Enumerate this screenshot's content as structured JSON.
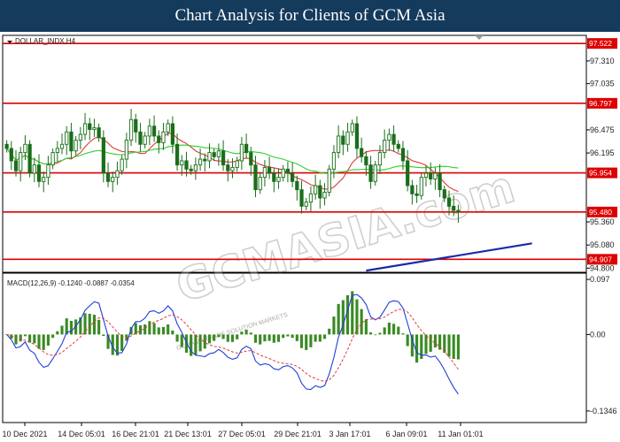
{
  "header": {
    "title": "Chart Analysis for Clients of GCM Asia"
  },
  "watermark": {
    "text": "GCMASIA.com",
    "sub": "GCMASIA TRADE SOLUTION MARKETS"
  },
  "colors": {
    "header_bg": "#143a5c",
    "candle": "#1a6e1a",
    "level_line": "#dd0000",
    "ma_red": "#e03a3a",
    "ma_green": "#2bd12b",
    "trend": "#1c2aa8",
    "macd_line": "#1f3fd8",
    "macd_signal": "#e03a3a",
    "histogram": "#3a8a24"
  },
  "chart_data": [
    {
      "type": "candlestick",
      "symbol_label": "DOLLAR_INDX,H4",
      "ylim": [
        94.75,
        97.62
      ],
      "y_ticks": [
        "97.310",
        "97.035",
        "96.475",
        "96.195",
        "95.360",
        "95.080",
        "94.800"
      ],
      "x_ticks": [
        "10 Dec 2021",
        "14 Dec 05:01",
        "16 Dec 21:01",
        "21 Dec 13:01",
        "27 Dec 05:01",
        "29 Dec 21:01",
        "3 Jan 17:01",
        "6 Jan 09:01",
        "11 Jan 01:01"
      ],
      "levels": [
        {
          "value": 97.522,
          "label": "97.522"
        },
        {
          "value": 96.797,
          "label": "96.797"
        },
        {
          "value": 95.954,
          "label": "95.954"
        },
        {
          "value": 95.48,
          "label": "95.480"
        },
        {
          "value": 94.907,
          "label": "94.907"
        }
      ],
      "trendline": {
        "from": [
          78,
          94.77
        ],
        "to": [
          114,
          95.1
        ]
      },
      "closes": [
        96.25,
        96.1,
        95.98,
        96.2,
        96.3,
        95.95,
        96.05,
        95.85,
        95.9,
        96.05,
        96.2,
        96.25,
        96.3,
        96.45,
        96.22,
        96.35,
        96.42,
        96.55,
        96.48,
        96.5,
        96.38,
        95.95,
        95.85,
        95.9,
        95.98,
        96.12,
        96.35,
        96.6,
        96.45,
        96.3,
        96.4,
        96.52,
        96.4,
        96.32,
        96.45,
        96.55,
        96.3,
        96.05,
        96.1,
        96.0,
        95.98,
        96.05,
        96.12,
        96.1,
        96.2,
        96.15,
        96.22,
        96.05,
        95.98,
        96.02,
        96.1,
        96.3,
        96.2,
        96.05,
        95.75,
        95.9,
        96.02,
        95.95,
        95.85,
        95.9,
        96.0,
        95.95,
        95.85,
        95.75,
        95.55,
        95.6,
        95.7,
        95.8,
        95.65,
        95.72,
        96.0,
        96.2,
        96.4,
        96.3,
        96.45,
        96.55,
        96.25,
        96.15,
        96.05,
        95.85,
        96.05,
        96.2,
        96.35,
        96.42,
        96.3,
        96.25,
        96.1,
        95.8,
        95.7,
        95.68,
        95.9,
        95.95,
        95.88,
        95.95,
        95.75,
        95.65,
        95.55,
        95.5,
        95.48
      ]
    },
    {
      "type": "macd",
      "label": "MACD(12,26,9) -0.1240 -0.0887 -0.0354",
      "ylim": [
        -0.155,
        0.108
      ],
      "y_ticks": [
        {
          "value": 0.097,
          "label": "0.097"
        },
        {
          "value": 0.0,
          "label": "0.00"
        },
        {
          "value": -0.1346,
          "label": "-0.1346"
        }
      ]
    }
  ]
}
